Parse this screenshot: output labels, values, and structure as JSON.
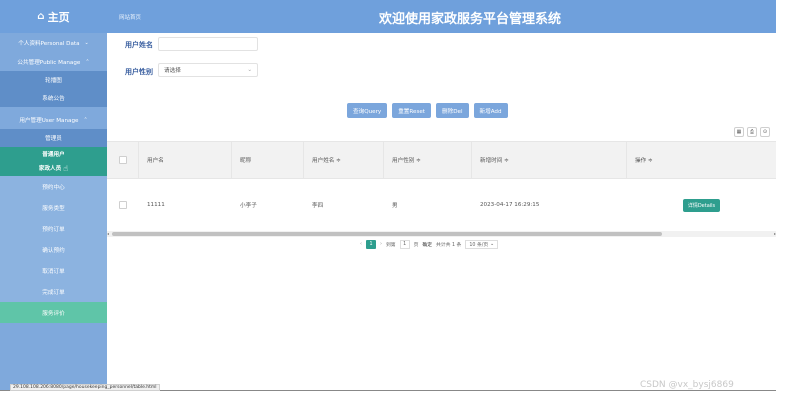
{
  "topbar": {
    "brand": "主页",
    "breadcrumb": "网站首页",
    "title": "欢迎使用家政服务平台管理系统"
  },
  "sidebar": {
    "groups": [
      {
        "label": "个人资料Personal Data"
      },
      {
        "label": "公共管理Public Manage"
      },
      {
        "label": "用户管理User Manage"
      }
    ],
    "public_items": [
      {
        "label": "轮播图"
      },
      {
        "label": "系统公告"
      }
    ],
    "user_items": [
      {
        "label": "管理员"
      },
      {
        "label": "普通用户"
      },
      {
        "label": "家政人员"
      }
    ],
    "other_items": [
      {
        "label": "预约中心"
      },
      {
        "label": "服务类型"
      },
      {
        "label": "预约订单"
      },
      {
        "label": "确认预约"
      },
      {
        "label": "取消订单"
      },
      {
        "label": "完成订单"
      },
      {
        "label": "服务评价"
      }
    ]
  },
  "search": {
    "name_label": "用户姓名",
    "gender_label": "用户性别",
    "gender_value": "请选择"
  },
  "buttons": {
    "query": "查询Query",
    "reset": "重置Reset",
    "delete": "删除Del",
    "add": "新增Add"
  },
  "table": {
    "headers": [
      "用户名",
      "昵称",
      "用户姓名 ≑",
      "用户性别 ≑",
      "新增时间 ≑",
      "操作 ≑"
    ],
    "rows": [
      {
        "username": "11111",
        "nickname": "小李子",
        "realname": "李四",
        "gender": "男",
        "created": "2023-04-17 16:29:15",
        "action": "详情Details"
      }
    ]
  },
  "pager": {
    "current": "1",
    "goto": "到第",
    "page_input": "1",
    "page_unit": "页",
    "confirm": "确定",
    "total": "共计共 1 条",
    "page_size": "10 条/页"
  },
  "status_url": "29.108.108.206:8080/page/housekeeping_personnel/table.html",
  "watermark": "CSDN @vx_bysj6869"
}
